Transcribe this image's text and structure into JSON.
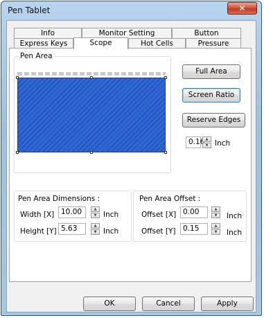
{
  "window": {
    "title": "Pen Tablet",
    "close_glyph": "✕"
  },
  "tabs": {
    "row1": [
      "Info",
      "Monitor Setting",
      "Button"
    ],
    "row2": [
      "Express Keys",
      "Scope",
      "Hot Cells",
      "Pressure"
    ],
    "active": "Scope"
  },
  "pen_area": {
    "group_label": "Pen Area",
    "full_area_label": "Full Area",
    "screen_ratio_label": "Screen Ratio",
    "reserve_edges_label": "Reserve Edges",
    "reserve_value": "0.16",
    "reserve_unit": "Inch",
    "area_color": "#2f67d6"
  },
  "dimensions": {
    "group_label": "Pen Area Dimensions :",
    "width_label": "Width [X]",
    "width_value": "10.00",
    "height_label": "Height [Y]",
    "height_value": "5.63",
    "unit": "Inch"
  },
  "offset": {
    "group_label": "Pen Area Offset :",
    "x_label": "Offset [X]",
    "x_value": "0.00",
    "y_label": "Offset [Y]",
    "y_value": "0.15",
    "unit": "Inch"
  },
  "footer": {
    "ok_label": "OK",
    "cancel_label": "Cancel",
    "apply_label": "Apply"
  },
  "icons": {
    "spin_up": "▲",
    "spin_down": "▼"
  }
}
